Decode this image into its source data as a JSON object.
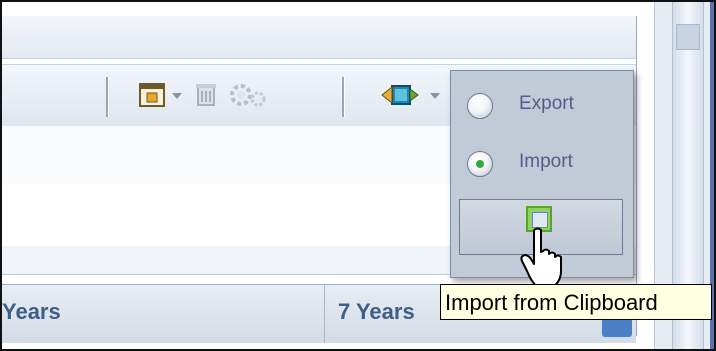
{
  "menu": {
    "items": [
      {
        "label": "Export",
        "selected": false
      },
      {
        "label": "Import",
        "selected": true
      }
    ],
    "action_button_icon": "import-from-clipboard-icon",
    "tooltip": "Import from Clipboard"
  },
  "grid": {
    "headers": [
      "Years",
      "7 Years"
    ]
  },
  "toolbar": {
    "icons": [
      "window-icon",
      "delete-icon",
      "settings-icon",
      "import-export-icon"
    ]
  },
  "colors": {
    "menu_bg": "#c1cbd8",
    "header_text": "#3f5e86",
    "selected_dot": "#2fae3c",
    "tooltip_bg": "#ffffe1"
  }
}
